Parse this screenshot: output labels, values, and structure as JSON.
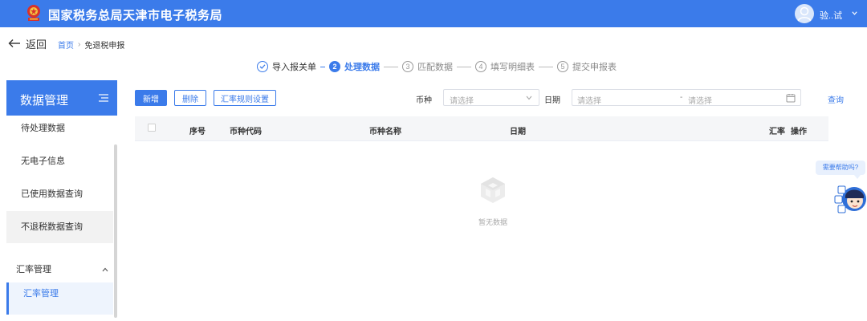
{
  "header": {
    "title": "国家税务总局天津市电子税务局",
    "user_name": "验..试",
    "colors": {
      "primary": "#3b7bea",
      "emblem_red": "#d8322a",
      "emblem_gold": "#f4c542"
    }
  },
  "nav": {
    "back_label": "返回",
    "breadcrumb": [
      "首页",
      "免退税申报"
    ]
  },
  "steps": [
    {
      "num": "1",
      "label": "导入报关单",
      "state": "done"
    },
    {
      "num": "2",
      "label": "处理数据",
      "state": "active"
    },
    {
      "num": "3",
      "label": "匹配数据",
      "state": "pending"
    },
    {
      "num": "4",
      "label": "填写明细表",
      "state": "pending"
    },
    {
      "num": "5",
      "label": "提交申报表",
      "state": "pending"
    }
  ],
  "sidebar": {
    "title": "数据管理",
    "items": [
      {
        "label": "待处理数据"
      },
      {
        "label": "无电子信息"
      },
      {
        "label": "已使用数据查询"
      },
      {
        "label": "不退税数据查询"
      }
    ],
    "group": {
      "label": "汇率管理",
      "expanded": true
    },
    "sub_item": {
      "label": "汇率管理",
      "selected": true
    }
  },
  "toolbar": {
    "add": "新增",
    "delete": "删除",
    "rate_rules": "汇率规则设置",
    "currency_label": "币种",
    "currency_placeholder": "请选择",
    "date_label": "日期",
    "date_start_placeholder": "请选择",
    "date_separator": "-",
    "date_end_placeholder": "请选择",
    "query": "查询"
  },
  "table": {
    "columns": [
      "序号",
      "币种代码",
      "币种名称",
      "日期",
      "汇率",
      "操作"
    ],
    "rows": [],
    "empty_text": "暂无数据"
  },
  "help": {
    "bubble": "需要帮助吗?"
  },
  "icons": [
    "national-emblem-icon",
    "user-avatar-icon",
    "chevron-down-icon",
    "back-arrow-icon",
    "check-circle-icon",
    "menu-icon",
    "calendar-icon",
    "empty-box-icon",
    "assistant-mascot-icon"
  ]
}
